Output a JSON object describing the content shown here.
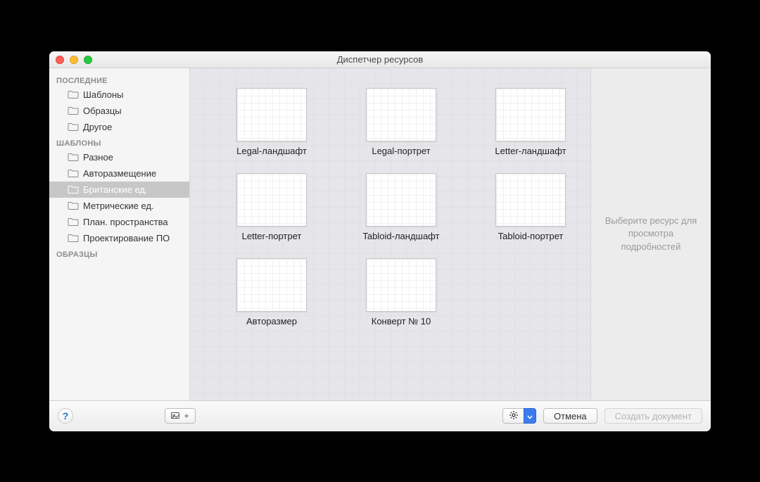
{
  "window": {
    "title": "Диспетчер ресурсов"
  },
  "sidebar": {
    "sections": [
      {
        "head": "ПОСЛЕДНИЕ",
        "items": [
          {
            "label": "Шаблоны",
            "selected": false
          },
          {
            "label": "Образцы",
            "selected": false
          },
          {
            "label": "Другое",
            "selected": false
          }
        ]
      },
      {
        "head": "ШАБЛОНЫ",
        "items": [
          {
            "label": "Разное",
            "selected": false
          },
          {
            "label": "Авторазмещение",
            "selected": false
          },
          {
            "label": "Британские ед.",
            "selected": true
          },
          {
            "label": "Метрические ед.",
            "selected": false
          },
          {
            "label": "План. пространства",
            "selected": false
          },
          {
            "label": "Проектирование ПО",
            "selected": false
          }
        ]
      },
      {
        "head": "ОБРАЗЦЫ",
        "items": []
      }
    ]
  },
  "templates": [
    {
      "label": "Legal-ландшафт"
    },
    {
      "label": "Legal-портрет"
    },
    {
      "label": "Letter-ландшафт"
    },
    {
      "label": "Letter-портрет"
    },
    {
      "label": "Tabloid-ландшафт"
    },
    {
      "label": "Tabloid-портрет"
    },
    {
      "label": "Авторазмер"
    },
    {
      "label": "Конверт № 10"
    }
  ],
  "details": {
    "placeholder": "Выберите ресурс для просмотра подробностей"
  },
  "footer": {
    "help": "?",
    "add_glyph": "⎘+",
    "cancel": "Отмена",
    "create": "Создать документ"
  }
}
